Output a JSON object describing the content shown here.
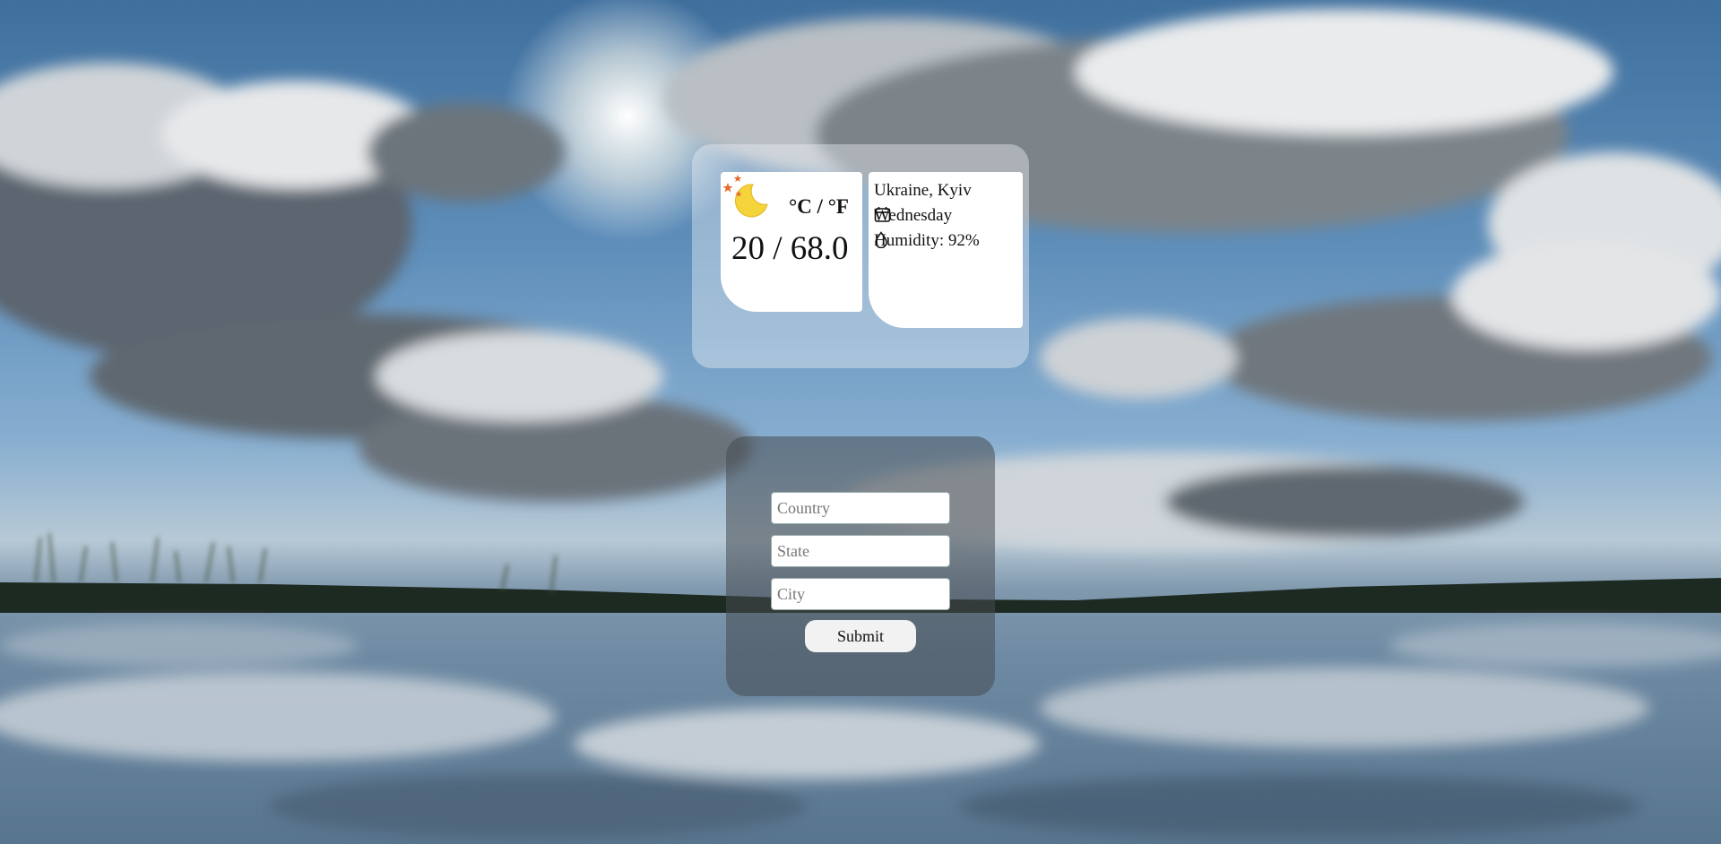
{
  "weather": {
    "icon": "moon-stars-icon",
    "units_label": "°C / °F",
    "temperature": "20 / 68.0",
    "location": "Ukraine, Kyiv",
    "day": "Wednesday",
    "humidity": "Humidity: 92%"
  },
  "form": {
    "country_placeholder": "Country",
    "state_placeholder": "State",
    "city_placeholder": "City",
    "submit_label": "Submit"
  },
  "colors": {
    "moon": "#f5d33b",
    "stars": "#e8692d"
  }
}
